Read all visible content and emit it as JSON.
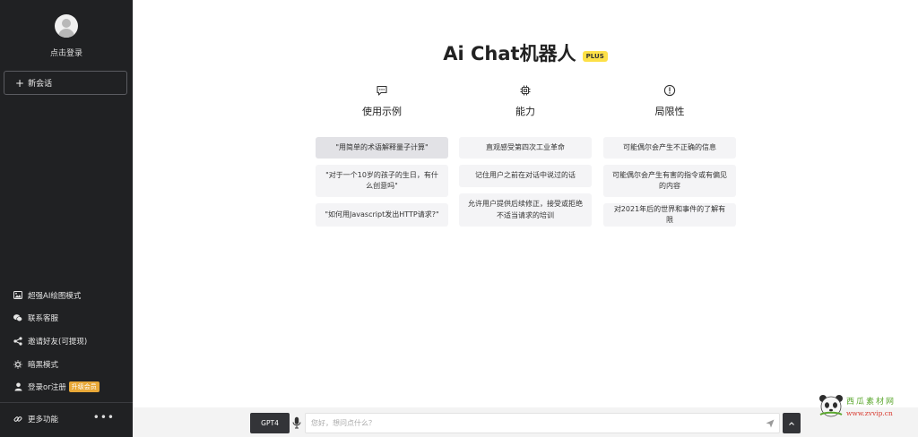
{
  "sidebar": {
    "login_label": "点击登录",
    "new_chat_label": "新会话",
    "menu": [
      {
        "label": "超强AI绘图模式",
        "icon": "image-icon"
      },
      {
        "label": "联系客服",
        "icon": "wechat-icon"
      },
      {
        "label": "邀请好友(可提现)",
        "icon": "share-icon"
      },
      {
        "label": "暗黑模式",
        "icon": "sun-icon"
      },
      {
        "label": "登录or注册",
        "icon": "user-icon",
        "badge": "升级会员"
      }
    ],
    "more_label": "更多功能",
    "more_dots": "•••"
  },
  "main": {
    "title": "Ai Chat机器人",
    "title_badge": "PLUS",
    "columns": [
      {
        "icon": "message-icon",
        "title": "使用示例",
        "cards": [
          "\"用简单的术语解释量子计算\"",
          "\"对于一个10岁的孩子的生日，有什么创意吗\"",
          "\"如何用Javascript发出HTTP请求?\""
        ]
      },
      {
        "icon": "chip-icon",
        "title": "能力",
        "cards": [
          "直观感受第四次工业革命",
          "记住用户之前在对话中说过的话",
          "允许用户提供后续修正，接受或拒绝不适当请求的培训"
        ]
      },
      {
        "icon": "warning-icon",
        "title": "局限性",
        "cards": [
          "可能偶尔会产生不正确的信息",
          "可能偶尔会产生有害的指令或有偏见的内容",
          "对2021年后的世界和事件的了解有限"
        ]
      }
    ]
  },
  "input_bar": {
    "model_label": "GPT4",
    "placeholder": "您好，想问点什么？",
    "value": ""
  },
  "watermark": {
    "cn_text": "西瓜素材网",
    "url_text": "www.zvvip.cn"
  },
  "colors": {
    "sidebar_bg": "#202123",
    "accent_dark": "#333438",
    "plus_badge": "#fde047",
    "upgrade_badge": "#e8a838"
  }
}
